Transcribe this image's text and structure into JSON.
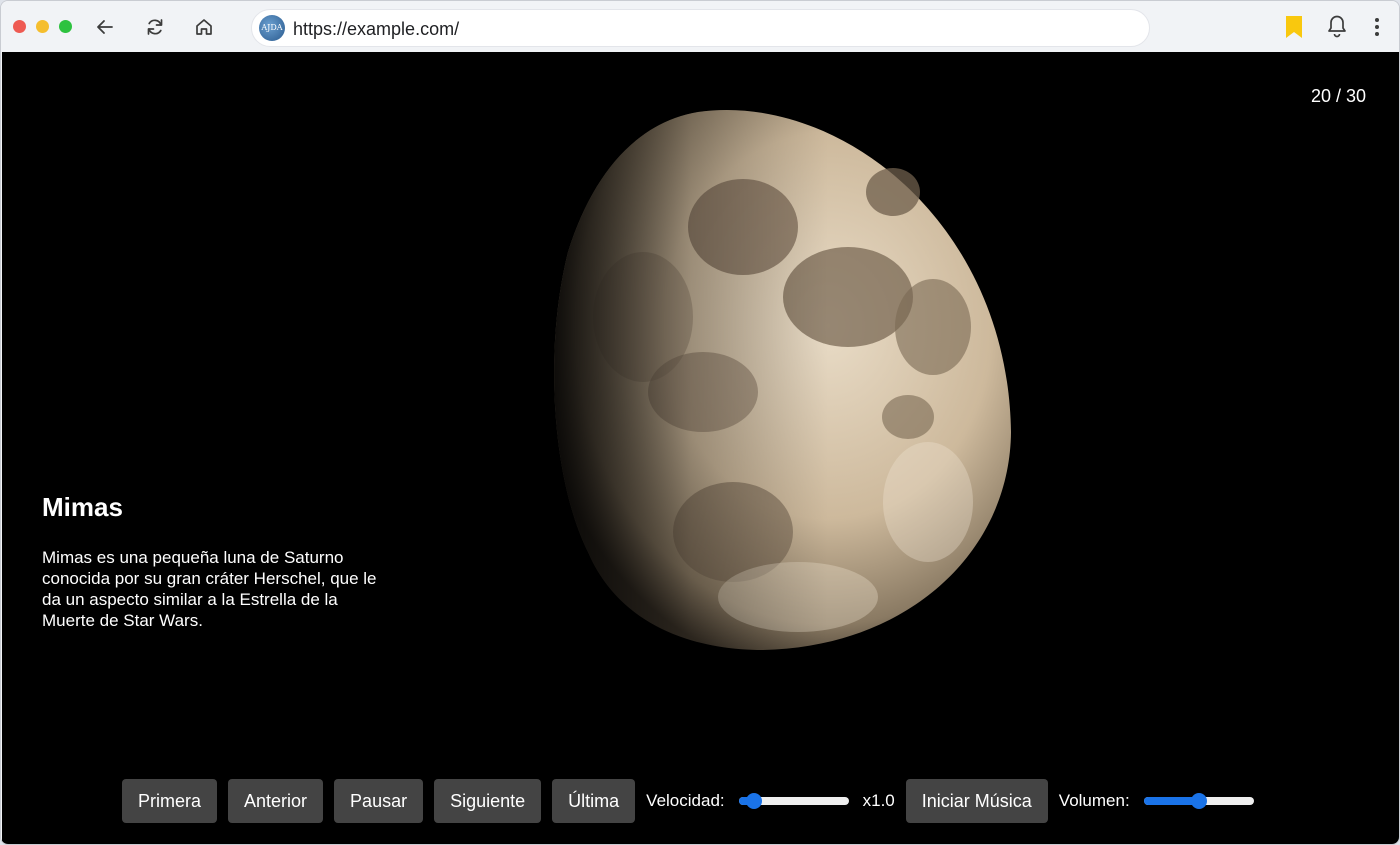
{
  "browser": {
    "url": "https://example.com/",
    "site_icon_text": "AJDA"
  },
  "slideshow": {
    "counter": "20 / 30",
    "title": "Mimas",
    "description": "Mimas es una pequeña luna de Saturno conocida por su gran cráter Herschel, que le da un aspecto similar a la Estrella de la Muerte de Star Wars."
  },
  "controls": {
    "first_label": "Primera",
    "prev_label": "Anterior",
    "pause_label": "Pausar",
    "next_label": "Siguiente",
    "last_label": "Última",
    "speed_label": "Velocidad:",
    "speed_value": "x1.0",
    "speed_level": 0.08,
    "music_label": "Iniciar Música",
    "volume_label": "Volumen:",
    "volume_level": 0.5
  },
  "colors": {
    "accent": "#1a73e8",
    "button_bg": "#444444",
    "bookmark": "#f9c80e"
  },
  "icons": [
    "back-icon",
    "reload-icon",
    "home-icon",
    "bookmark-icon",
    "bell-icon",
    "menu-icon"
  ]
}
